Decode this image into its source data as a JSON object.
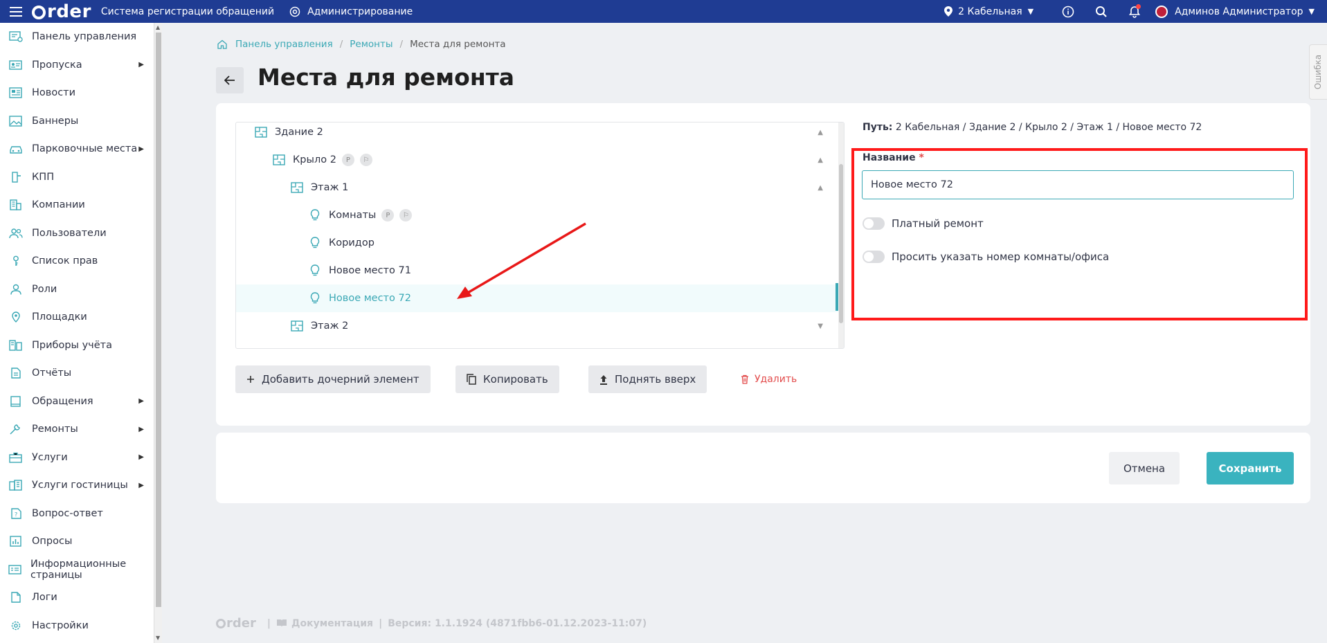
{
  "topbar": {
    "logo_text": "rder",
    "system_title": "Система регистрации обращений",
    "admin_label": "Администрирование",
    "location": "2 Кабельная",
    "user_name": "Админов Администратор"
  },
  "sidebar": {
    "items": [
      {
        "label": "Панель управления",
        "icon": "dashboard-icon"
      },
      {
        "label": "Пропуска",
        "icon": "pass-icon",
        "has_submenu": true
      },
      {
        "label": "Новости",
        "icon": "news-icon"
      },
      {
        "label": "Баннеры",
        "icon": "banner-icon"
      },
      {
        "label": "Парковочные места",
        "icon": "car-icon",
        "has_submenu": true
      },
      {
        "label": "КПП",
        "icon": "checkpoint-icon"
      },
      {
        "label": "Компании",
        "icon": "building-icon"
      },
      {
        "label": "Пользователи",
        "icon": "users-icon"
      },
      {
        "label": "Список прав",
        "icon": "key-icon"
      },
      {
        "label": "Роли",
        "icon": "user-icon"
      },
      {
        "label": "Площадки",
        "icon": "location-icon"
      },
      {
        "label": "Приборы учёта",
        "icon": "meter-icon"
      },
      {
        "label": "Отчёты",
        "icon": "report-icon"
      },
      {
        "label": "Обращения",
        "icon": "book-icon",
        "has_submenu": true
      },
      {
        "label": "Ремонты",
        "icon": "wrench-icon",
        "has_submenu": true
      },
      {
        "label": "Услуги",
        "icon": "briefcase-icon",
        "has_submenu": true
      },
      {
        "label": "Услуги гостиницы",
        "icon": "hotel-icon",
        "has_submenu": true
      },
      {
        "label": "Вопрос-ответ",
        "icon": "faq-icon"
      },
      {
        "label": "Опросы",
        "icon": "poll-icon"
      },
      {
        "label": "Информационные страницы",
        "icon": "info-page-icon"
      },
      {
        "label": "Логи",
        "icon": "log-icon"
      },
      {
        "label": "Настройки",
        "icon": "gear-icon"
      }
    ]
  },
  "breadcrumb": {
    "items": [
      "Панель управления",
      "Ремонты"
    ],
    "current": "Места для ремонта"
  },
  "page": {
    "title": "Места для ремонта"
  },
  "tree": {
    "rows": [
      {
        "label": "Здание 2",
        "icon": "plan-icon",
        "level": 1,
        "expand": "up"
      },
      {
        "label": "Крыло 2",
        "icon": "plan-icon",
        "level": 2,
        "expand": "up",
        "badges": [
          "P",
          "⚐"
        ]
      },
      {
        "label": "Этаж 1",
        "icon": "plan-icon",
        "level": 3,
        "expand": "up"
      },
      {
        "label": "Комнаты",
        "icon": "bulb-icon",
        "level": 4,
        "badges": [
          "P",
          "⚐"
        ]
      },
      {
        "label": "Коридор",
        "icon": "bulb-icon",
        "level": 4
      },
      {
        "label": "Новое место 71",
        "icon": "bulb-icon",
        "level": 4
      },
      {
        "label": "Новое место 72",
        "icon": "bulb-icon",
        "level": 4,
        "selected": true
      },
      {
        "label": "Этаж 2",
        "icon": "plan-icon",
        "level": 3,
        "expand": "down"
      }
    ]
  },
  "actions": {
    "add_child": "Добавить дочерний элемент",
    "copy": "Копировать",
    "move_up": "Поднять вверх",
    "delete": "Удалить"
  },
  "details": {
    "path_label": "Путь:",
    "path_value": "2 Кабельная / Здание 2 / Крыло 2 / Этаж 1 / Новое место 72",
    "name_label": "Название",
    "required_mark": "*",
    "name_value": "Новое место 72",
    "paid_repair_label": "Платный ремонт",
    "paid_repair_on": false,
    "ask_room_label": "Просить указать номер комнаты/офиса",
    "ask_room_on": false
  },
  "footer_buttons": {
    "cancel": "Отмена",
    "save": "Сохранить"
  },
  "error_tab": "Ошибка",
  "footer": {
    "logo_text": "rder",
    "docs": "Документация",
    "version": "Версия: 1.1.1924 (4871fbb6-01.12.2023-11:07)"
  },
  "colors": {
    "topbar": "#1f3c93",
    "accent": "#3ab3bf",
    "danger": "#e24a4a",
    "highlight_box": "#ff1a1a"
  }
}
